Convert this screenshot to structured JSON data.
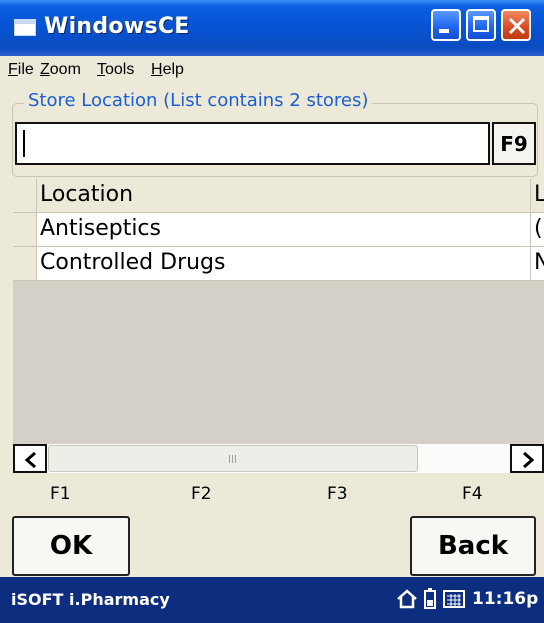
{
  "window": {
    "title": "WindowsCE"
  },
  "menu": {
    "items": [
      {
        "key": "F",
        "rest": "ile"
      },
      {
        "key": "Z",
        "rest": "oom"
      },
      {
        "key": "T",
        "rest": "ools"
      },
      {
        "key": "H",
        "rest": "elp"
      }
    ]
  },
  "store": {
    "group_label": "Store Location (List contains 2 stores)",
    "search_value": "",
    "f9_label": "F9"
  },
  "grid": {
    "headers": [
      "Location",
      "L"
    ],
    "rows": [
      [
        "Antiseptics",
        "("
      ],
      [
        "Controlled Drugs",
        "N"
      ]
    ]
  },
  "fkeys": [
    "F1",
    "F2",
    "F3",
    "F4"
  ],
  "buttons": {
    "ok": "OK",
    "back": "Back"
  },
  "taskbar": {
    "app_name": "iSOFT i.Pharmacy",
    "clock": "11:16p",
    "icons": [
      "home-icon",
      "battery-icon",
      "keyboard-icon"
    ]
  }
}
